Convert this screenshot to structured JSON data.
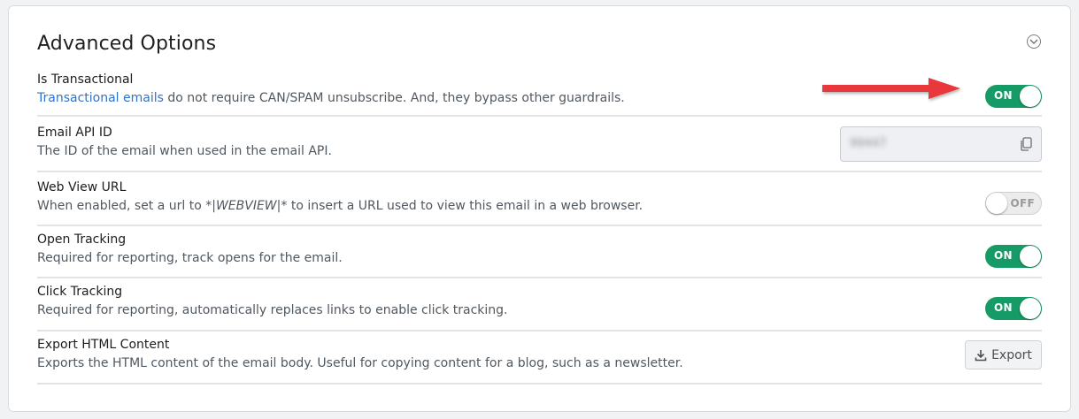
{
  "section": {
    "title": "Advanced Options"
  },
  "rows": {
    "transactional": {
      "title": "Is Transactional",
      "link_text": "Transactional emails",
      "desc_rest": " do not require CAN/SPAM unsubscribe. And, they bypass other guardrails.",
      "toggle_label": "ON"
    },
    "api_id": {
      "title": "Email API ID",
      "desc": "The ID of the email when used in the email API.",
      "value": "99447"
    },
    "webview": {
      "title": "Web View URL",
      "desc_pre": "When enabled, set a url to ",
      "desc_code": "*|WEBVIEW|*",
      "desc_post": " to insert a URL used to view this email in a web browser.",
      "toggle_label": "OFF"
    },
    "open_tracking": {
      "title": "Open Tracking",
      "desc": "Required for reporting, track opens for the email.",
      "toggle_label": "ON"
    },
    "click_tracking": {
      "title": "Click Tracking",
      "desc": "Required for reporting, automatically replaces links to enable click tracking.",
      "toggle_label": "ON"
    },
    "export_html": {
      "title": "Export HTML Content",
      "desc": "Exports the HTML content of the email body. Useful for copying content for a blog, such as a newsletter.",
      "button_label": "Export"
    }
  },
  "colors": {
    "toggle_on": "#169a66",
    "link": "#2f73c9",
    "annotation_arrow": "#e8393b"
  },
  "icons": [
    "chevron-down-icon",
    "copy-icon",
    "download-icon"
  ]
}
